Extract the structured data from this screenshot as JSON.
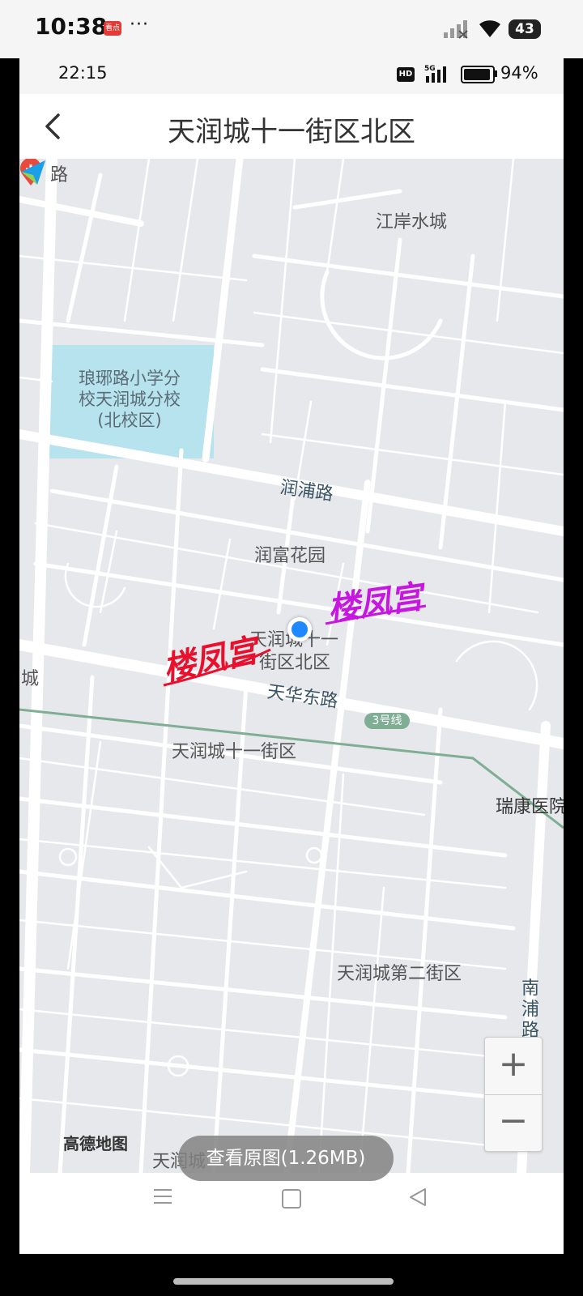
{
  "outer_status": {
    "time": "10:38",
    "app_badge": "看点",
    "more": "···",
    "battery": "43"
  },
  "inner_status": {
    "time": "22:15",
    "network": "5G",
    "battery": "94%"
  },
  "header": {
    "title": "天润城十一街区北区"
  },
  "map": {
    "labels": {
      "road_top_left": "路",
      "jiangan": "江岸水城",
      "school": "琅琊路小学分校天润城分校(北校区)",
      "school_line1": "琅琊路小学分",
      "school_line2": "校天润城分校",
      "school_line3": "(北校区)",
      "runpu_road": "润浦路",
      "runfu": "润富花园",
      "current_line1": "天润城十一",
      "current_line2": "街区北区",
      "cheng_left": "城",
      "tianhua_road": "天华东路",
      "metro_line": "3号线",
      "block11": "天润城十一街区",
      "hospital": "瑞康医院",
      "block2": "天润城第二街区",
      "nanpu_road": "南浦路",
      "bottom_partial": "天润城"
    },
    "watermark": "楼凤宫",
    "provider": "高德地图",
    "zoom_in": "+",
    "zoom_out": "−",
    "colors": {
      "background": "#e7e8ec",
      "roads": "#ffffff",
      "school_area": "#b6e3ee",
      "metro": "#7fae95",
      "location": "#1e88ff",
      "hospital": "#e84a3b"
    }
  },
  "bottom": {
    "view_original": "查看原图(1.26MB)"
  }
}
